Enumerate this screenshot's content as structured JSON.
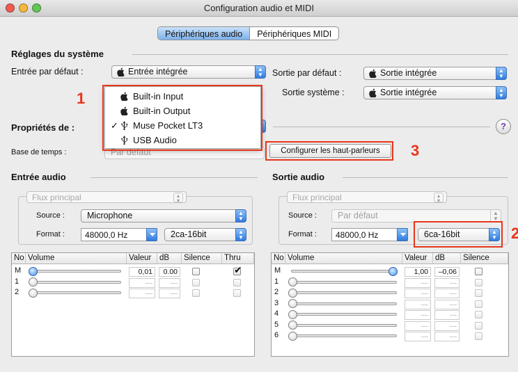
{
  "window": {
    "title": "Configuration audio et MIDI",
    "traffic_colors": [
      "#ee5c50",
      "#f5b73d",
      "#62c554"
    ]
  },
  "tabs": [
    {
      "label": "Périphériques audio",
      "selected": true
    },
    {
      "label": "Périphériques MIDI",
      "selected": false
    }
  ],
  "system": {
    "heading": "Réglages du système",
    "default_input_label": "Entrée par défaut :",
    "default_input_value": "Entrée intégrée",
    "default_output_label": "Sortie par défaut :",
    "default_output_value": "Sortie intégrée",
    "system_output_label": "Sortie système :",
    "system_output_value": "Sortie intégrée"
  },
  "properties": {
    "label": "Propriétés de :",
    "help": "?",
    "time_base_label": "Base de temps :",
    "time_base_value": "Par défaut",
    "configure_speakers": "Configurer les haut-parleurs"
  },
  "device_menu": {
    "items": [
      {
        "label": "Built-in Input",
        "icon": "apple-icon",
        "checked": false
      },
      {
        "label": "Built-in Output",
        "icon": "apple-icon",
        "checked": false
      },
      {
        "label": "Muse Pocket LT3",
        "icon": "usb-icon",
        "checked": true
      },
      {
        "label": "USB Audio",
        "icon": "usb-icon",
        "checked": false
      }
    ],
    "check_glyph": "✓"
  },
  "audio_input": {
    "heading": "Entrée audio",
    "stream": "Flux principal",
    "source_label": "Source :",
    "source_value": "Microphone",
    "format_label": "Format :",
    "rate": "48000,0 Hz",
    "channels": "2ca-16bit",
    "columns": [
      "No",
      "Volume",
      "Valeur",
      "dB",
      "Silence",
      "Thru"
    ],
    "rows": [
      {
        "no": "M",
        "value": "0,01",
        "db": "0.00",
        "volume": 0.0,
        "thru": true,
        "active": true
      },
      {
        "no": "1",
        "value": "—",
        "db": "—",
        "volume": 0.0,
        "thru": false,
        "active": false
      },
      {
        "no": "2",
        "value": "—",
        "db": "—",
        "volume": 0.0,
        "thru": false,
        "active": false
      }
    ]
  },
  "audio_output": {
    "heading": "Sortie audio",
    "stream": "Flux principal",
    "source_label": "Source :",
    "source_value": "Par défaut",
    "format_label": "Format :",
    "rate": "48000,0 Hz",
    "channels": "6ca-16bit",
    "columns": [
      "No",
      "Volume",
      "Valeur",
      "dB",
      "Silence"
    ],
    "rows": [
      {
        "no": "M",
        "value": "1,00",
        "db": "–0,06",
        "volume": 1.0,
        "active": true
      },
      {
        "no": "1",
        "value": "—",
        "db": "—",
        "volume": 0.0,
        "active": false
      },
      {
        "no": "2",
        "value": "—",
        "db": "—",
        "volume": 0.0,
        "active": false
      },
      {
        "no": "3",
        "value": "—",
        "db": "—",
        "volume": 0.0,
        "active": false
      },
      {
        "no": "4",
        "value": "—",
        "db": "—",
        "volume": 0.0,
        "active": false
      },
      {
        "no": "5",
        "value": "—",
        "db": "—",
        "volume": 0.0,
        "active": false
      },
      {
        "no": "6",
        "value": "—",
        "db": "—",
        "volume": 0.0,
        "active": false
      }
    ]
  },
  "annotations": {
    "one": "1",
    "two": "2",
    "three": "3",
    "color": "#e8351a"
  }
}
